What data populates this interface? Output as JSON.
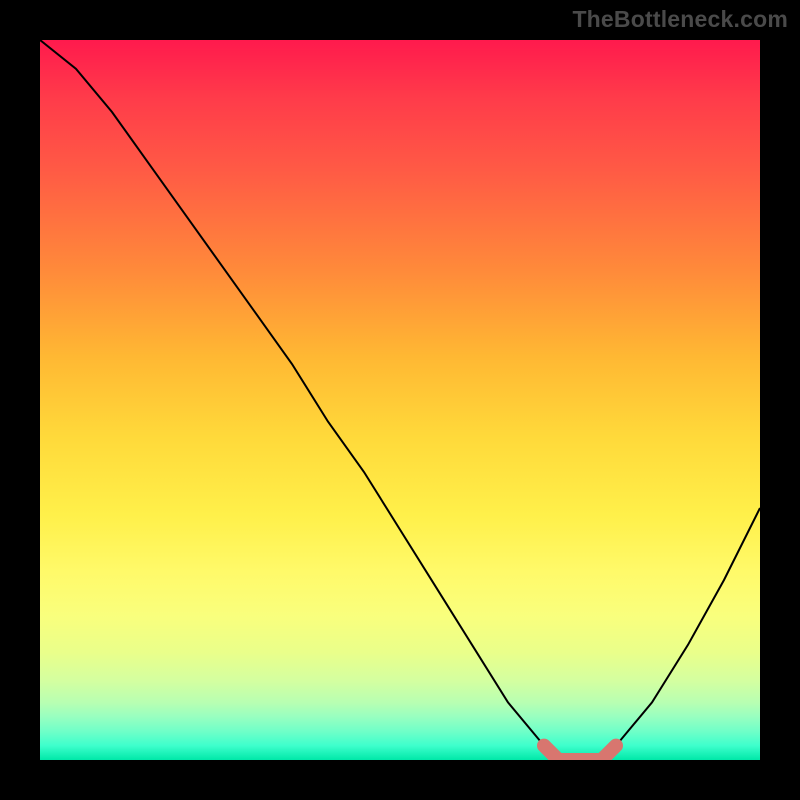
{
  "watermark": "TheBottleneck.com",
  "chart_data": {
    "type": "line",
    "title": "",
    "xlabel": "",
    "ylabel": "",
    "xlim": [
      0,
      100
    ],
    "ylim": [
      0,
      100
    ],
    "grid": false,
    "legend": false,
    "background": {
      "type": "vertical-gradient",
      "stops": [
        {
          "pos": 0,
          "color": "#ff1a4d"
        },
        {
          "pos": 50,
          "color": "#ffd93a"
        },
        {
          "pos": 85,
          "color": "#eaff8a"
        },
        {
          "pos": 100,
          "color": "#00e8a8"
        }
      ],
      "note": "red at top → green at bottom implies top = high bottleneck, bottom = low"
    },
    "series": [
      {
        "name": "bottleneck-curve",
        "color": "#000000",
        "stroke_width": 2,
        "x": [
          0,
          5,
          10,
          15,
          20,
          25,
          30,
          35,
          40,
          45,
          50,
          55,
          60,
          65,
          70,
          72,
          75,
          78,
          80,
          85,
          90,
          95,
          100
        ],
        "y": [
          100,
          96,
          90,
          83,
          76,
          69,
          62,
          55,
          47,
          40,
          32,
          24,
          16,
          8,
          2,
          0,
          0,
          0,
          2,
          8,
          16,
          25,
          35
        ],
        "note": "y is bottleneck magnitude (higher = worse). Valley floor ~72–78 on x."
      },
      {
        "name": "optimal-range-marker",
        "color": "#d8766f",
        "stroke_width": 14,
        "linecap": "round",
        "x": [
          70,
          72,
          75,
          78,
          80
        ],
        "y": [
          2,
          0,
          0,
          0,
          2
        ],
        "note": "short thick segment hugging the valley floor"
      }
    ]
  }
}
